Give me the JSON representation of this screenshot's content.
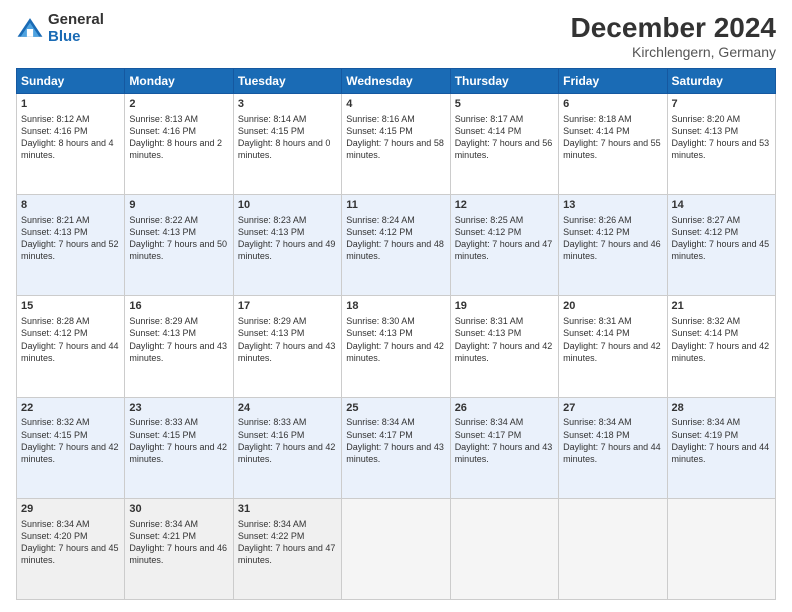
{
  "logo": {
    "general": "General",
    "blue": "Blue"
  },
  "title": "December 2024",
  "location": "Kirchlengern, Germany",
  "headers": [
    "Sunday",
    "Monday",
    "Tuesday",
    "Wednesday",
    "Thursday",
    "Friday",
    "Saturday"
  ],
  "weeks": [
    [
      {
        "day": "1",
        "sunrise": "Sunrise: 8:12 AM",
        "sunset": "Sunset: 4:16 PM",
        "daylight": "Daylight: 8 hours and 4 minutes."
      },
      {
        "day": "2",
        "sunrise": "Sunrise: 8:13 AM",
        "sunset": "Sunset: 4:16 PM",
        "daylight": "Daylight: 8 hours and 2 minutes."
      },
      {
        "day": "3",
        "sunrise": "Sunrise: 8:14 AM",
        "sunset": "Sunset: 4:15 PM",
        "daylight": "Daylight: 8 hours and 0 minutes."
      },
      {
        "day": "4",
        "sunrise": "Sunrise: 8:16 AM",
        "sunset": "Sunset: 4:15 PM",
        "daylight": "Daylight: 7 hours and 58 minutes."
      },
      {
        "day": "5",
        "sunrise": "Sunrise: 8:17 AM",
        "sunset": "Sunset: 4:14 PM",
        "daylight": "Daylight: 7 hours and 56 minutes."
      },
      {
        "day": "6",
        "sunrise": "Sunrise: 8:18 AM",
        "sunset": "Sunset: 4:14 PM",
        "daylight": "Daylight: 7 hours and 55 minutes."
      },
      {
        "day": "7",
        "sunrise": "Sunrise: 8:20 AM",
        "sunset": "Sunset: 4:13 PM",
        "daylight": "Daylight: 7 hours and 53 minutes."
      }
    ],
    [
      {
        "day": "8",
        "sunrise": "Sunrise: 8:21 AM",
        "sunset": "Sunset: 4:13 PM",
        "daylight": "Daylight: 7 hours and 52 minutes."
      },
      {
        "day": "9",
        "sunrise": "Sunrise: 8:22 AM",
        "sunset": "Sunset: 4:13 PM",
        "daylight": "Daylight: 7 hours and 50 minutes."
      },
      {
        "day": "10",
        "sunrise": "Sunrise: 8:23 AM",
        "sunset": "Sunset: 4:13 PM",
        "daylight": "Daylight: 7 hours and 49 minutes."
      },
      {
        "day": "11",
        "sunrise": "Sunrise: 8:24 AM",
        "sunset": "Sunset: 4:12 PM",
        "daylight": "Daylight: 7 hours and 48 minutes."
      },
      {
        "day": "12",
        "sunrise": "Sunrise: 8:25 AM",
        "sunset": "Sunset: 4:12 PM",
        "daylight": "Daylight: 7 hours and 47 minutes."
      },
      {
        "day": "13",
        "sunrise": "Sunrise: 8:26 AM",
        "sunset": "Sunset: 4:12 PM",
        "daylight": "Daylight: 7 hours and 46 minutes."
      },
      {
        "day": "14",
        "sunrise": "Sunrise: 8:27 AM",
        "sunset": "Sunset: 4:12 PM",
        "daylight": "Daylight: 7 hours and 45 minutes."
      }
    ],
    [
      {
        "day": "15",
        "sunrise": "Sunrise: 8:28 AM",
        "sunset": "Sunset: 4:12 PM",
        "daylight": "Daylight: 7 hours and 44 minutes."
      },
      {
        "day": "16",
        "sunrise": "Sunrise: 8:29 AM",
        "sunset": "Sunset: 4:13 PM",
        "daylight": "Daylight: 7 hours and 43 minutes."
      },
      {
        "day": "17",
        "sunrise": "Sunrise: 8:29 AM",
        "sunset": "Sunset: 4:13 PM",
        "daylight": "Daylight: 7 hours and 43 minutes."
      },
      {
        "day": "18",
        "sunrise": "Sunrise: 8:30 AM",
        "sunset": "Sunset: 4:13 PM",
        "daylight": "Daylight: 7 hours and 42 minutes."
      },
      {
        "day": "19",
        "sunrise": "Sunrise: 8:31 AM",
        "sunset": "Sunset: 4:13 PM",
        "daylight": "Daylight: 7 hours and 42 minutes."
      },
      {
        "day": "20",
        "sunrise": "Sunrise: 8:31 AM",
        "sunset": "Sunset: 4:14 PM",
        "daylight": "Daylight: 7 hours and 42 minutes."
      },
      {
        "day": "21",
        "sunrise": "Sunrise: 8:32 AM",
        "sunset": "Sunset: 4:14 PM",
        "daylight": "Daylight: 7 hours and 42 minutes."
      }
    ],
    [
      {
        "day": "22",
        "sunrise": "Sunrise: 8:32 AM",
        "sunset": "Sunset: 4:15 PM",
        "daylight": "Daylight: 7 hours and 42 minutes."
      },
      {
        "day": "23",
        "sunrise": "Sunrise: 8:33 AM",
        "sunset": "Sunset: 4:15 PM",
        "daylight": "Daylight: 7 hours and 42 minutes."
      },
      {
        "day": "24",
        "sunrise": "Sunrise: 8:33 AM",
        "sunset": "Sunset: 4:16 PM",
        "daylight": "Daylight: 7 hours and 42 minutes."
      },
      {
        "day": "25",
        "sunrise": "Sunrise: 8:34 AM",
        "sunset": "Sunset: 4:17 PM",
        "daylight": "Daylight: 7 hours and 43 minutes."
      },
      {
        "day": "26",
        "sunrise": "Sunrise: 8:34 AM",
        "sunset": "Sunset: 4:17 PM",
        "daylight": "Daylight: 7 hours and 43 minutes."
      },
      {
        "day": "27",
        "sunrise": "Sunrise: 8:34 AM",
        "sunset": "Sunset: 4:18 PM",
        "daylight": "Daylight: 7 hours and 44 minutes."
      },
      {
        "day": "28",
        "sunrise": "Sunrise: 8:34 AM",
        "sunset": "Sunset: 4:19 PM",
        "daylight": "Daylight: 7 hours and 44 minutes."
      }
    ],
    [
      {
        "day": "29",
        "sunrise": "Sunrise: 8:34 AM",
        "sunset": "Sunset: 4:20 PM",
        "daylight": "Daylight: 7 hours and 45 minutes."
      },
      {
        "day": "30",
        "sunrise": "Sunrise: 8:34 AM",
        "sunset": "Sunset: 4:21 PM",
        "daylight": "Daylight: 7 hours and 46 minutes."
      },
      {
        "day": "31",
        "sunrise": "Sunrise: 8:34 AM",
        "sunset": "Sunset: 4:22 PM",
        "daylight": "Daylight: 7 hours and 47 minutes."
      },
      null,
      null,
      null,
      null
    ]
  ]
}
